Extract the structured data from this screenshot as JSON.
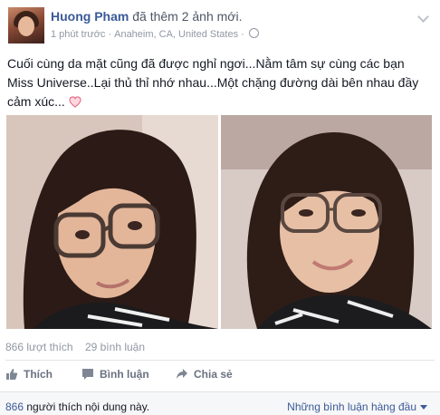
{
  "post": {
    "author": "Huong Pham",
    "action": "đã thêm 2 ảnh mới.",
    "time": "1 phút trước",
    "location": "Anaheim, CA, United States",
    "status_text": "Cuối cùng da mặt cũng đã được nghỉ ngơi...Nằm tâm sự cùng các bạn Miss Universe..Lại thủ thỉ nhớ nhau...Một chặng đường dài bên nhau đầy cảm xúc..."
  },
  "stats": {
    "likes": "866 lượt thích",
    "comments": "29 bình luận"
  },
  "actions": {
    "like_label": "Thích",
    "comment_label": "Bình luận",
    "share_label": "Chia sẻ"
  },
  "footer": {
    "like_count": "866",
    "like_text": " người thích nội dung này.",
    "sort_label": "Những bình luận hàng đầu"
  },
  "colors": {
    "link": "#3b5998",
    "muted": "#9197a3",
    "footer_bg": "#f6f7f8"
  }
}
